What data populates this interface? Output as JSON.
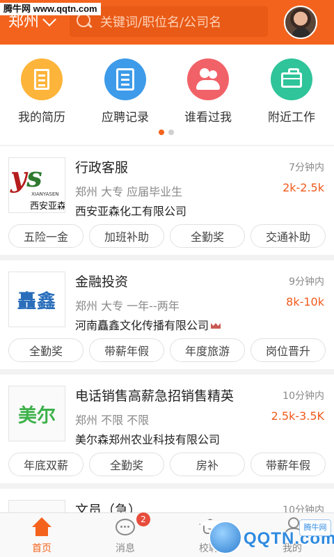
{
  "watermark": {
    "top_left": "腾牛网 www.qqtn.com",
    "bottom_right_text": "QQTN.com",
    "bottom_right_badge": "腾牛网"
  },
  "header": {
    "city": "郑州",
    "search_placeholder": "关键词/职位名/公司名"
  },
  "quick_menu": [
    {
      "label": "我的简历",
      "icon": "resume-icon",
      "color": "#fdb43a"
    },
    {
      "label": "应聘记录",
      "icon": "list-icon",
      "color": "#3d9be9"
    },
    {
      "label": "谁看过我",
      "icon": "users-icon",
      "color": "#f16268"
    },
    {
      "label": "附近工作",
      "icon": "briefcase-icon",
      "color": "#2fc49a"
    }
  ],
  "pager": {
    "count": 2,
    "active": 1
  },
  "jobs": [
    {
      "title": "行政客服",
      "time": "7分钟内",
      "meta": "郑州 大专 应届毕业生",
      "salary": "2k-2.5k",
      "company": "西安亚森化工有限公司",
      "vip": false,
      "logo": {
        "brand": "ys",
        "caption": "XIANYASEN",
        "name": "西安亚森"
      },
      "tags": [
        "五险一金",
        "加班补助",
        "全勤奖",
        "交通补助"
      ]
    },
    {
      "title": "金融投资",
      "time": "9分钟内",
      "meta": "郑州 大专 一年--两年",
      "salary": "8k-10k",
      "company": "河南矗鑫文化传播有限公司",
      "vip": true,
      "logo": {
        "brand": "矗鑫"
      },
      "tags": [
        "全勤奖",
        "带薪年假",
        "年度旅游",
        "岗位晋升"
      ]
    },
    {
      "title": "电话销售高薪急招销售精英",
      "time": "10分钟内",
      "meta": "郑州 不限 不限",
      "salary": "2.5k-3.5K",
      "company": "美尔森郑州农业科技有限公司",
      "vip": false,
      "logo": {
        "brand": "美尔"
      },
      "tags": [
        "年底双薪",
        "全勤奖",
        "房补",
        "带薪年假"
      ]
    },
    {
      "title": "文员（急）",
      "time": "10分钟内"
    }
  ],
  "bottom_nav": [
    {
      "label": "首页",
      "icon": "home-icon",
      "active": true
    },
    {
      "label": "消息",
      "icon": "message-icon",
      "badge": "2"
    },
    {
      "label": "校聘",
      "icon": "graduation-cap-icon"
    },
    {
      "label": "我的",
      "icon": "person-icon"
    }
  ],
  "colors": {
    "brand": "#f4631d",
    "salary": "#f05a1a",
    "badge": "#e74c3c"
  }
}
